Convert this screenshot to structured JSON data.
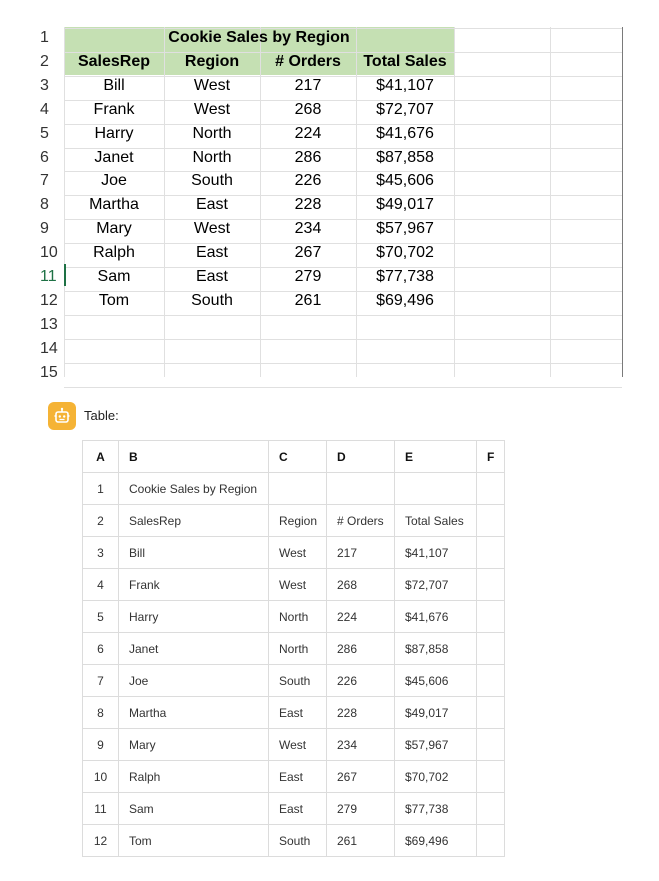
{
  "spreadsheet": {
    "row_numbers": [
      "1",
      "2",
      "3",
      "4",
      "5",
      "6",
      "7",
      "8",
      "9",
      "10",
      "11",
      "12",
      "13",
      "14",
      "15"
    ],
    "active_row": "11",
    "title": "Cookie Sales by Region",
    "headers": [
      "SalesRep",
      "Region",
      "# Orders",
      "Total Sales"
    ],
    "rows": [
      [
        "Bill",
        "West",
        "217",
        "$41,107"
      ],
      [
        "Frank",
        "West",
        "268",
        "$72,707"
      ],
      [
        "Harry",
        "North",
        "224",
        "$41,676"
      ],
      [
        "Janet",
        "North",
        "286",
        "$87,858"
      ],
      [
        "Joe",
        "South",
        "226",
        "$45,606"
      ],
      [
        "Martha",
        "East",
        "228",
        "$49,017"
      ],
      [
        "Mary",
        "West",
        "234",
        "$57,967"
      ],
      [
        "Ralph",
        "East",
        "267",
        "$70,702"
      ],
      [
        "Sam",
        "East",
        "279",
        "$77,738"
      ],
      [
        "Tom",
        "South",
        "261",
        "$69,496"
      ]
    ],
    "colors": {
      "title_fill": "#c5e0b3",
      "active_row_number": "#1e7145"
    }
  },
  "assistant": {
    "avatar_icon": "robot-icon",
    "avatar_color": "#f5b335",
    "label": "Table:"
  },
  "table": {
    "columns": [
      "A",
      "B",
      "C",
      "D",
      "E",
      "F"
    ],
    "rows": [
      [
        "1",
        "Cookie Sales by Region",
        "",
        "",
        "",
        ""
      ],
      [
        "2",
        "SalesRep",
        "Region",
        "# Orders",
        "Total Sales",
        ""
      ],
      [
        "3",
        "Bill",
        "West",
        "217",
        "$41,107",
        ""
      ],
      [
        "4",
        "Frank",
        "West",
        "268",
        "$72,707",
        ""
      ],
      [
        "5",
        "Harry",
        "North",
        "224",
        "$41,676",
        ""
      ],
      [
        "6",
        "Janet",
        "North",
        "286",
        "$87,858",
        ""
      ],
      [
        "7",
        "Joe",
        "South",
        "226",
        "$45,606",
        ""
      ],
      [
        "8",
        "Martha",
        "East",
        "228",
        "$49,017",
        ""
      ],
      [
        "9",
        "Mary",
        "West",
        "234",
        "$57,967",
        ""
      ],
      [
        "10",
        "Ralph",
        "East",
        "267",
        "$70,702",
        ""
      ],
      [
        "11",
        "Sam",
        "East",
        "279",
        "$77,738",
        ""
      ],
      [
        "12",
        "Tom",
        "South",
        "261",
        "$69,496",
        ""
      ]
    ]
  }
}
